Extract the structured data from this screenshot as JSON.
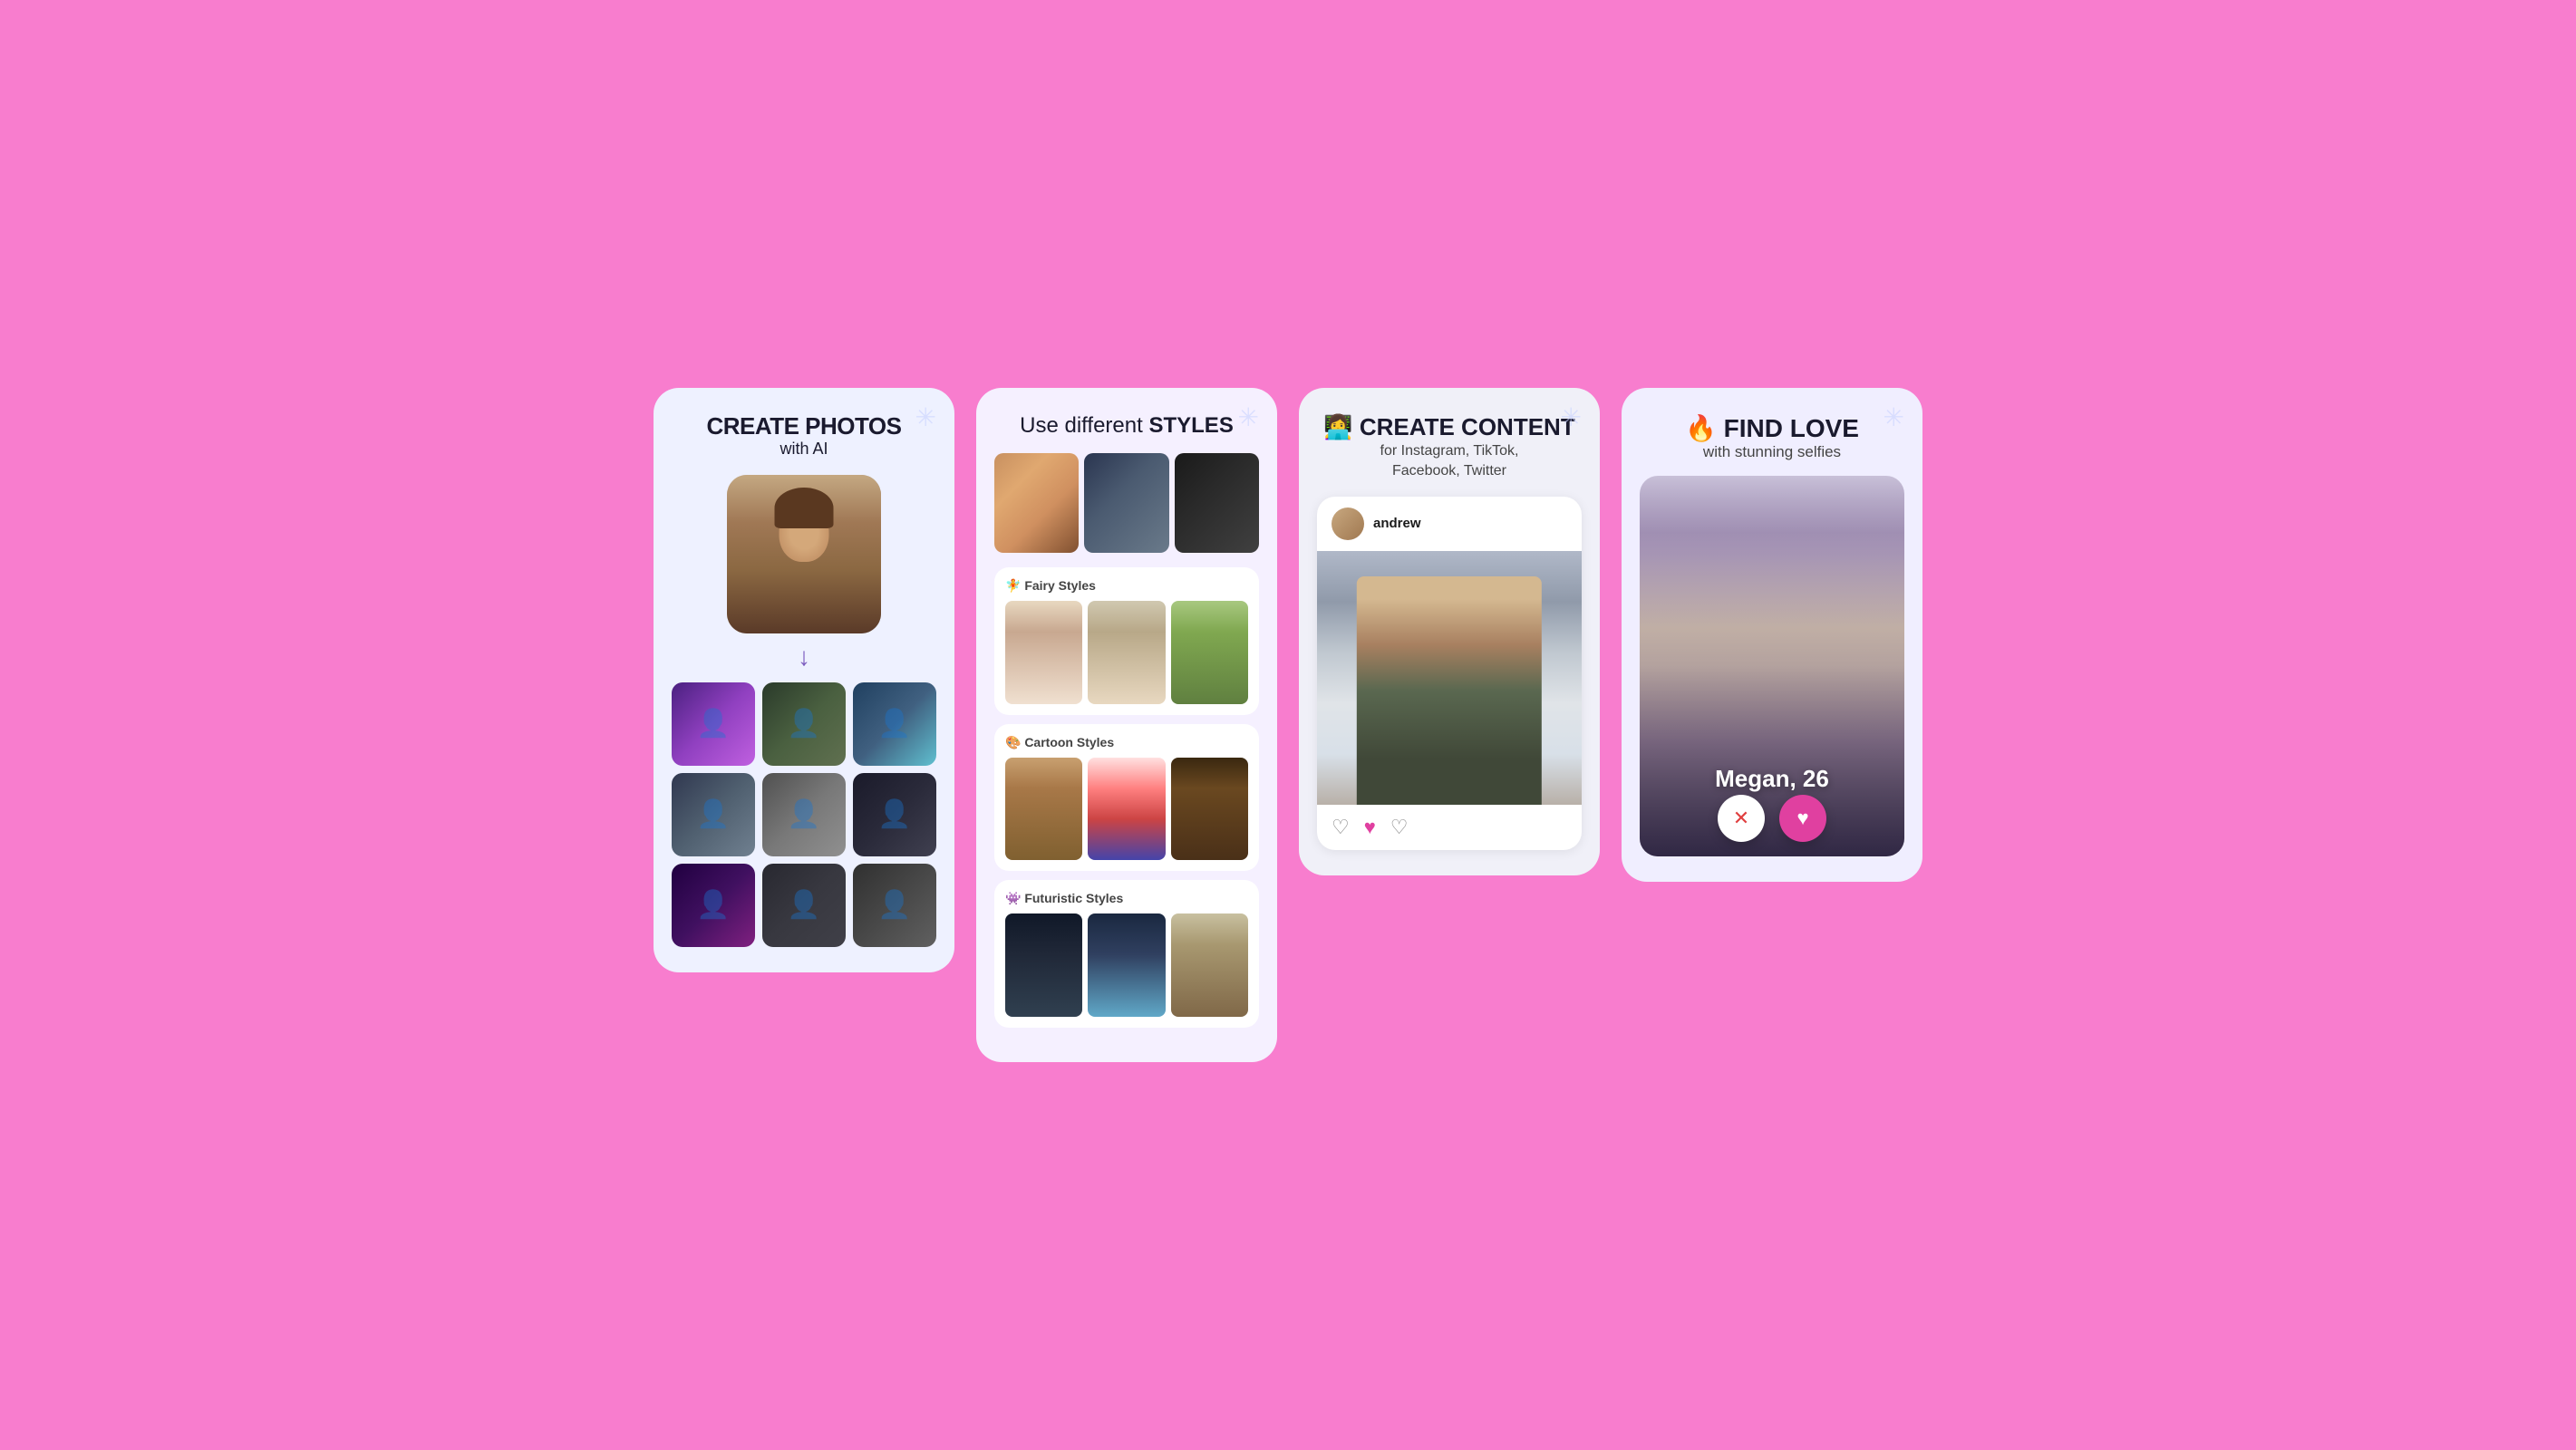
{
  "card1": {
    "title": "CREATE PHOTOS",
    "subtitle": "with AI",
    "arrow": "↓"
  },
  "card2": {
    "title_prefix": "Use different ",
    "title_bold": "STYLES",
    "fairy_label": "🧚 Fairy Styles",
    "cartoon_label": "🎨 Cartoon Styles",
    "futuristic_label": "👾 Futuristic Styles"
  },
  "card3": {
    "title": "👩‍💻 CREATE CONTENT",
    "subtitle": "for Instagram, TikTok,\nFacebook, Twitter",
    "username": "andrew"
  },
  "card4": {
    "title": "🔥 FIND LOVE",
    "subtitle": "with stunning selfies",
    "person_name": "Megan, 26",
    "btn_x": "✕",
    "btn_heart": "♥"
  }
}
